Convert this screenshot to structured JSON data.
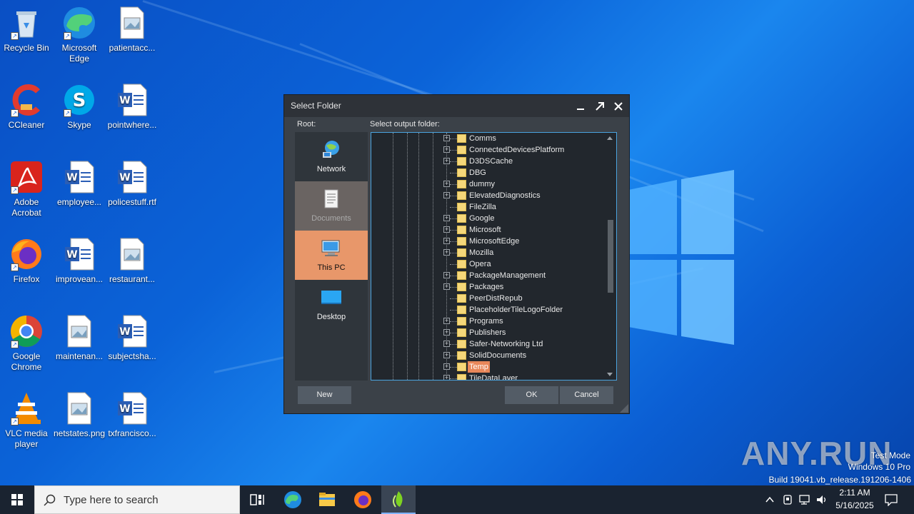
{
  "desktop_icons": [
    {
      "label": "Recycle Bin",
      "icon": "recycle-bin-icon"
    },
    {
      "label": "Microsoft Edge",
      "icon": "edge-icon"
    },
    {
      "label": "patientacc...",
      "icon": "image-file-icon"
    },
    {
      "label": "CCleaner",
      "icon": "ccleaner-icon"
    },
    {
      "label": "Skype",
      "icon": "skype-icon"
    },
    {
      "label": "pointwhere...",
      "icon": "word-doc-icon"
    },
    {
      "label": "Adobe Acrobat",
      "icon": "acrobat-icon"
    },
    {
      "label": "employee...",
      "icon": "word-doc-icon"
    },
    {
      "label": "policestuff.rtf",
      "icon": "word-doc-icon"
    },
    {
      "label": "Firefox",
      "icon": "firefox-icon"
    },
    {
      "label": "improvean...",
      "icon": "word-doc-icon"
    },
    {
      "label": "restaurant...",
      "icon": "image-file-icon"
    },
    {
      "label": "Google Chrome",
      "icon": "chrome-icon"
    },
    {
      "label": "maintenan...",
      "icon": "image-file-icon"
    },
    {
      "label": "subjectsha...",
      "icon": "word-doc-icon"
    },
    {
      "label": "VLC media player",
      "icon": "vlc-icon"
    },
    {
      "label": "netstates.png",
      "icon": "image-file-icon"
    },
    {
      "label": "txfrancisco...",
      "icon": "word-doc-icon"
    }
  ],
  "dialog": {
    "title": "Select Folder",
    "root_label": "Root:",
    "output_label": "Select output folder:",
    "roots": [
      {
        "label": "Network",
        "icon": "network-icon",
        "state": "normal"
      },
      {
        "label": "Documents",
        "icon": "documents-icon",
        "state": "hover"
      },
      {
        "label": "This PC",
        "icon": "this-pc-icon",
        "state": "selected"
      },
      {
        "label": "Desktop",
        "icon": "desktop-icon",
        "state": "normal"
      }
    ],
    "folders": [
      {
        "name": "Comms",
        "expandable": true
      },
      {
        "name": "ConnectedDevicesPlatform",
        "expandable": true
      },
      {
        "name": "D3DSCache",
        "expandable": true
      },
      {
        "name": "DBG",
        "expandable": false
      },
      {
        "name": "dummy",
        "expandable": true
      },
      {
        "name": "ElevatedDiagnostics",
        "expandable": true
      },
      {
        "name": "FileZilla",
        "expandable": false
      },
      {
        "name": "Google",
        "expandable": true
      },
      {
        "name": "Microsoft",
        "expandable": true
      },
      {
        "name": "MicrosoftEdge",
        "expandable": true
      },
      {
        "name": "Mozilla",
        "expandable": true
      },
      {
        "name": "Opera",
        "expandable": false
      },
      {
        "name": "PackageManagement",
        "expandable": true
      },
      {
        "name": "Packages",
        "expandable": true
      },
      {
        "name": "PeerDistRepub",
        "expandable": false
      },
      {
        "name": "PlaceholderTileLogoFolder",
        "expandable": false
      },
      {
        "name": "Programs",
        "expandable": true
      },
      {
        "name": "Publishers",
        "expandable": true
      },
      {
        "name": "Safer-Networking Ltd",
        "expandable": true
      },
      {
        "name": "SolidDocuments",
        "expandable": true
      },
      {
        "name": "Temp",
        "expandable": true,
        "selected": true
      },
      {
        "name": "TileDataLayer",
        "expandable": true
      }
    ],
    "buttons": {
      "new": "New",
      "ok": "OK",
      "cancel": "Cancel"
    }
  },
  "taskbar": {
    "search_placeholder": "Type here to search",
    "time": "2:11 AM",
    "date": "5/16/2025"
  },
  "watermark": {
    "brand": "ANY.RUN",
    "line1": "Test Mode",
    "line2": "Windows 10 Pro",
    "line3": "Build 19041.vb_release.191206-1406"
  }
}
